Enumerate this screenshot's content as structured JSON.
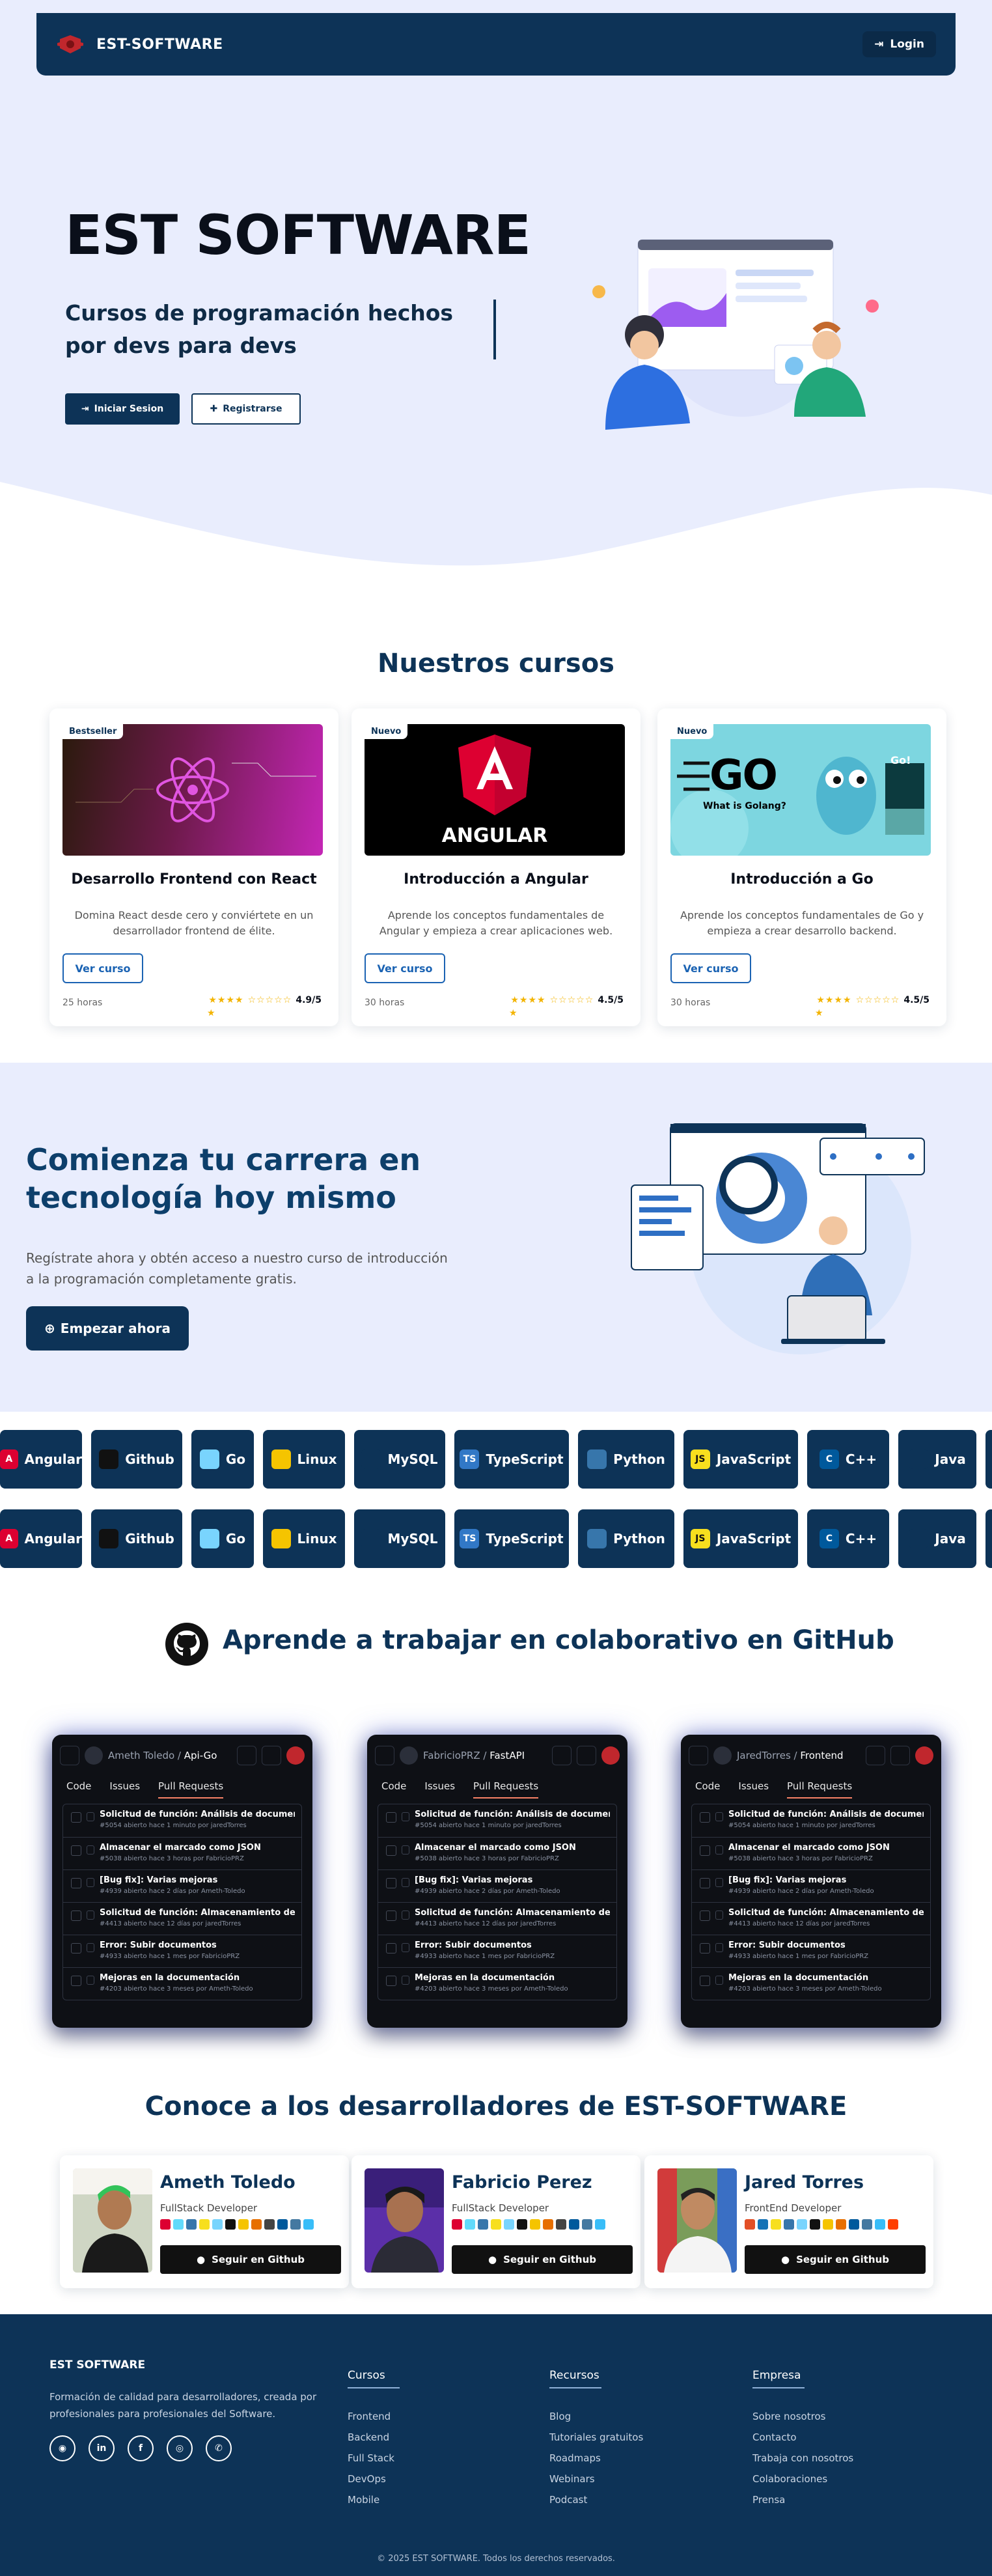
{
  "nav": {
    "brand": "EST-SOFTWARE",
    "login": "Login"
  },
  "hero": {
    "title": "EST SOFTWARE",
    "subtitle": "Cursos de programación hechos por devs para devs",
    "btn_login": "Iniciar Sesion",
    "btn_register": "Registrarse"
  },
  "courses": {
    "title": "Nuestros cursos",
    "items": [
      {
        "badge": "Bestseller",
        "title": "Desarrollo Frontend con React",
        "desc": "Domina React desde cero y conviértete en un desarrollador frontend de élite.",
        "button": "Ver curso",
        "hours": "25 horas",
        "rating": "4.9/5"
      },
      {
        "badge": "Nuevo",
        "title": "Introducción a Angular",
        "desc": "Aprende los conceptos fundamentales de Angular y empieza a crear aplicaciones web.",
        "button": "Ver curso",
        "hours": "30 horas",
        "rating": "4.5/5",
        "thumb_text": "ANGULAR"
      },
      {
        "badge": "Nuevo",
        "title": "Introducción a Go",
        "desc": "Aprende los conceptos fundamentales de Go y empieza a crear desarrollo backend.",
        "button": "Ver curso",
        "hours": "30 horas",
        "rating": "4.5/5",
        "thumb_text": "GO",
        "thumb_sub": "What is Golang?",
        "thumb_tag": "Go!"
      }
    ]
  },
  "cta": {
    "title": "Comienza tu carrera en tecnología hoy mismo",
    "text": "Regístrate ahora y obtén acceso a nuestro curso de introducción a la programación completamente gratis.",
    "button": "Empezar ahora"
  },
  "tech": {
    "labels": [
      "Angular",
      "Github",
      "Go",
      "Linux",
      "MySQL",
      "TypeScript",
      "Python",
      "JavaScript",
      "C++",
      "Java"
    ],
    "icons": [
      "A",
      "",
      "",
      "",
      "",
      "TS",
      "",
      "JS",
      "C",
      ""
    ]
  },
  "github": {
    "title": "Aprende a trabajar en colaborativo en GitHub",
    "tabs": [
      "Code",
      "Issues",
      "Pull Requests"
    ],
    "repos": [
      {
        "user": "Ameth Toledo",
        "repo": "Api-Go"
      },
      {
        "user": "FabricioPRZ",
        "repo": "FastAPI"
      },
      {
        "user": "JaredTorres",
        "repo": "Frontend"
      }
    ],
    "prs": [
      {
        "t": "Solicitud de función: Análisis de documentos",
        "m": "#5054 abierto hace 1 minuto por jaredTorres"
      },
      {
        "t": "Almacenar el marcado como JSON",
        "m": "#5038 abierto hace 3 horas por FabricioPRZ"
      },
      {
        "t": "[Bug fix]: Varias mejoras",
        "m": "#4939 abierto hace 2 días por Ameth-Toledo"
      },
      {
        "t": "Solicitud de función: Almacenamiento de cursos",
        "m": "#4413 abierto hace 12 días por jaredTorres"
      },
      {
        "t": "Error: Subir documentos",
        "m": "#4933 abierto hace 1 mes por FabricioPRZ"
      },
      {
        "t": "Mejoras en la documentación",
        "m": "#4203 abierto hace 3 meses por Ameth-Toledo"
      }
    ]
  },
  "devs": {
    "title": "Conoce a los desarrolladores de EST-SOFTWARE",
    "items": [
      {
        "name": "Ameth Toledo",
        "role": "FullStack Developer",
        "button": "Seguir en Github"
      },
      {
        "name": "Fabricio Perez",
        "role": "FullStack Developer",
        "button": "Seguir en Github"
      },
      {
        "name": "Jared Torres",
        "role": "FrontEnd Developer",
        "button": "Seguir en Github"
      }
    ]
  },
  "footer": {
    "brand": "EST SOFTWARE",
    "desc": "Formación de calidad para desarrolladores, creada por profesionales para profesionales del Software.",
    "columns": [
      {
        "title": "Cursos",
        "links": [
          "Frontend",
          "Backend",
          "Full Stack",
          "DevOps",
          "Mobile"
        ]
      },
      {
        "title": "Recursos",
        "links": [
          "Blog",
          "Tutoriales gratuitos",
          "Roadmaps",
          "Webinars",
          "Podcast"
        ]
      },
      {
        "title": "Empresa",
        "links": [
          "Sobre nosotros",
          "Contacto",
          "Trabaja con nosotros",
          "Colaboraciones",
          "Prensa"
        ]
      }
    ],
    "copyright": "© 2025 EST SOFTWARE. Todos los derechos reservados."
  },
  "colors": {
    "primary": "#0d3357",
    "hero_bg": "#e9edfd",
    "accent": "#1b63b3",
    "star": "#f3b400"
  }
}
